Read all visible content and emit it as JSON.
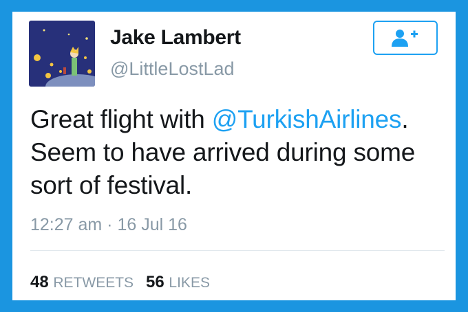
{
  "tweet": {
    "author_name": "Jake Lambert",
    "author_handle": "@LittleLostLad",
    "text_part1": "Great flight with ",
    "mention": "@TurkishAirlines",
    "text_part2": ". Seem to have arrived during some sort of festival.",
    "timestamp": "12:27 am · 16 Jul 16",
    "retweets_count": "48",
    "retweets_label": "RETWEETS",
    "likes_count": "56",
    "likes_label": "LIKES"
  },
  "icons": {
    "follow": "add-user-icon",
    "avatar": "little-prince-avatar"
  },
  "colors": {
    "frame": "#1b95e0",
    "accent": "#1da1f2",
    "text": "#14171a",
    "muted": "#8899a6"
  }
}
